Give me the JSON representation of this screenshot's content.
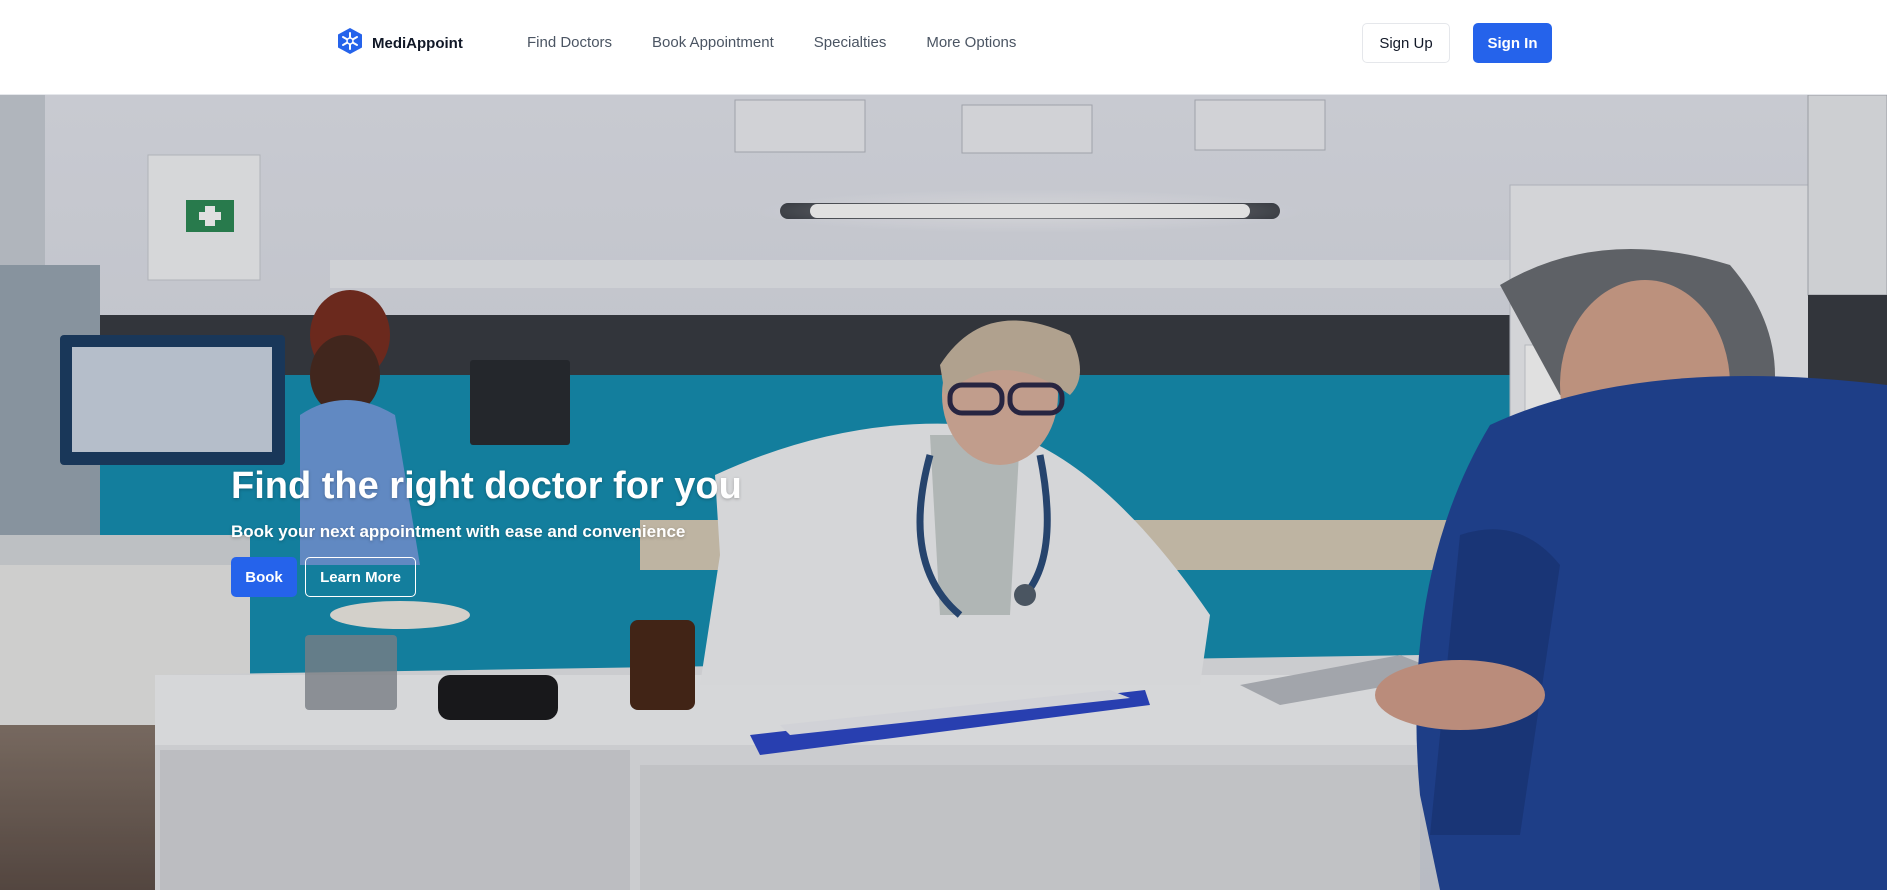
{
  "header": {
    "brand_name": "MediAppoint",
    "logo_icon": "hexagon-logo-icon",
    "nav_links": [
      {
        "label": "Find Doctors"
      },
      {
        "label": "Book Appointment"
      },
      {
        "label": "Specialties"
      },
      {
        "label": "More Options"
      }
    ],
    "sign_up_label": "Sign Up",
    "sign_in_label": "Sign In"
  },
  "hero": {
    "title": "Find the right doctor for you",
    "subtitle": "Book your next appointment with ease and convenience",
    "book_label": "Book",
    "learn_more_label": "Learn More"
  },
  "colors": {
    "accent": "#2563eb",
    "text_dark": "#111827",
    "text_nav": "#4b5563",
    "hero_wall_teal": "#1690b3"
  }
}
